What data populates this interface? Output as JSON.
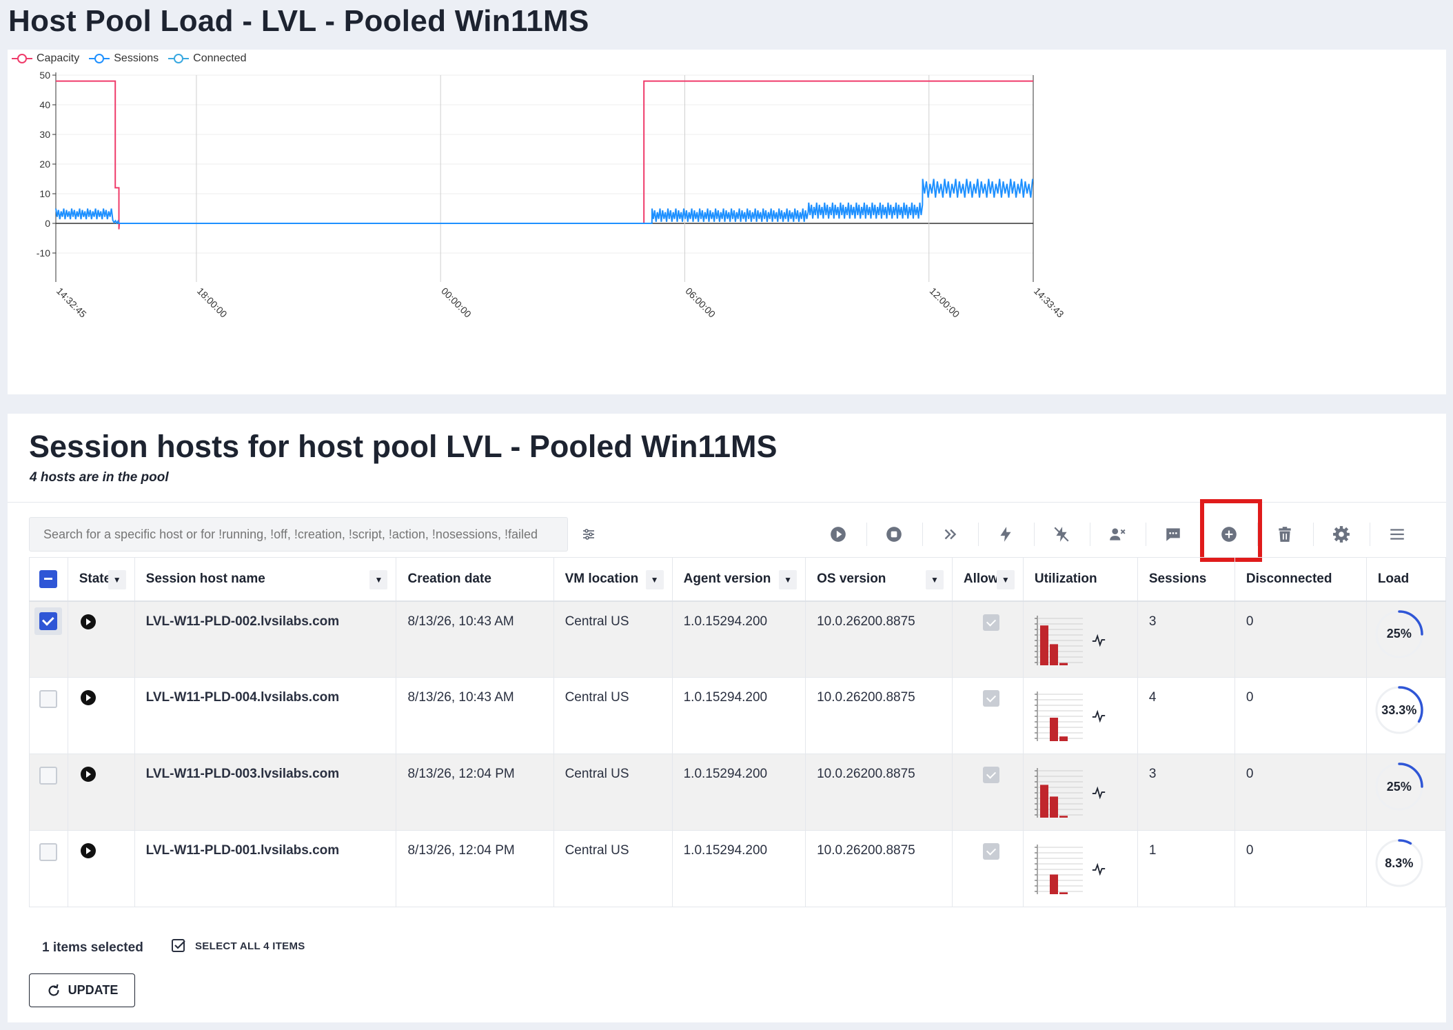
{
  "page": {
    "title": "Host Pool Load - LVL - Pooled Win11MS"
  },
  "colors": {
    "capacity": "#ef3b6a",
    "sessions": "#1e90ff",
    "connected": "#38a8e0",
    "accent": "#2f56d6",
    "highlight": "#e01b1b",
    "bar": "#c0262c"
  },
  "chart_data": {
    "type": "line",
    "legend": [
      "Capacity",
      "Sessions",
      "Connected"
    ],
    "y_ticks": [
      "50",
      "40",
      "30",
      "20",
      "10",
      "0",
      "-10"
    ],
    "ylim": [
      -10,
      50
    ],
    "x_tick_labels": [
      "14:32:45",
      "18:00:00",
      "00:00:00",
      "06:00:00",
      "12:00:00",
      "14:33:43"
    ],
    "x_range_hours": [
      0,
      24.016
    ],
    "x_tick_hours": [
      0,
      3.454,
      9.454,
      15.454,
      21.454,
      24.016
    ],
    "series": [
      {
        "name": "Capacity",
        "color": "#ef3b6a",
        "points": [
          [
            0,
            48
          ],
          [
            1.46,
            48
          ],
          [
            1.46,
            12
          ],
          [
            1.55,
            12
          ],
          [
            1.55,
            -2
          ],
          [
            1.56,
            0
          ],
          [
            14.45,
            0
          ],
          [
            14.45,
            48
          ],
          [
            24.016,
            48
          ]
        ]
      },
      {
        "name": "Sessions",
        "color": "#1e90ff",
        "oscillating": true,
        "segments": [
          {
            "from": 0,
            "to": 1.4,
            "low": 1,
            "high": 5
          },
          {
            "from": 1.4,
            "to": 1.55,
            "low": 0,
            "high": 1
          },
          {
            "from": 1.55,
            "to": 14.65,
            "low": 0,
            "high": 0
          },
          {
            "from": 14.65,
            "to": 18.5,
            "low": 0,
            "high": 5
          },
          {
            "from": 18.5,
            "to": 21.3,
            "low": 1,
            "high": 7
          },
          {
            "from": 21.3,
            "to": 24.016,
            "low": 8,
            "high": 15
          }
        ]
      }
    ]
  },
  "hosts": {
    "title": "Session hosts for host pool LVL - Pooled Win11MS",
    "subtitle": "4 hosts are in the pool",
    "search_placeholder": "Search for a specific host or for !running, !off, !creation, !script, !action, !nosessions, !failed",
    "toolbar": [
      "start-icon",
      "stop-icon",
      "forward-icon",
      "power-icon",
      "unpower-icon",
      "user-remove-icon",
      "message-icon",
      "add-icon",
      "delete-icon",
      "settings-icon",
      "menu-icon"
    ],
    "columns": {
      "state": "State",
      "name": "Session host name",
      "creation": "Creation date",
      "location": "VM location",
      "agent": "Agent version",
      "os": "OS version",
      "allow": "Allow",
      "utilization": "Utilization",
      "sessions": "Sessions",
      "disconnected": "Disconnected",
      "load": "Load"
    },
    "rows": [
      {
        "name": "LVL-W11-PLD-002.lvsilabs.com",
        "creation": "8/13/26, 10:43 AM",
        "location": "Central US",
        "agent": "1.0.15294.200",
        "os": "10.0.26200.8875",
        "sessions": "3",
        "disconnected": "0",
        "load": "25%",
        "load_value": 0.25,
        "selected": true,
        "bars": [
          0.85,
          0.45,
          0.05
        ]
      },
      {
        "name": "LVL-W11-PLD-004.lvsilabs.com",
        "creation": "8/13/26, 10:43 AM",
        "location": "Central US",
        "agent": "1.0.15294.200",
        "os": "10.0.26200.8875",
        "sessions": "4",
        "disconnected": "0",
        "load": "33.3%",
        "load_value": 0.333,
        "selected": false,
        "bars": [
          0,
          0.5,
          0.1
        ]
      },
      {
        "name": "LVL-W11-PLD-003.lvsilabs.com",
        "creation": "8/13/26, 12:04 PM",
        "location": "Central US",
        "agent": "1.0.15294.200",
        "os": "10.0.26200.8875",
        "sessions": "3",
        "disconnected": "0",
        "load": "25%",
        "load_value": 0.25,
        "selected": false,
        "bars": [
          0.7,
          0.45,
          0.04
        ]
      },
      {
        "name": "LVL-W11-PLD-001.lvsilabs.com",
        "creation": "8/13/26, 12:04 PM",
        "location": "Central US",
        "agent": "1.0.15294.200",
        "os": "10.0.26200.8875",
        "sessions": "1",
        "disconnected": "0",
        "load": "8.3%",
        "load_value": 0.083,
        "selected": false,
        "bars": [
          0,
          0.42,
          0.04
        ]
      }
    ],
    "items_selected": "1 items selected",
    "select_all": "SELECT ALL 4 ITEMS",
    "update": "UPDATE"
  }
}
